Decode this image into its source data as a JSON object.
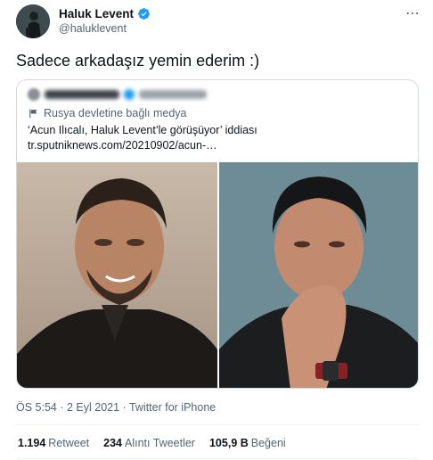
{
  "author": {
    "display_name": "Haluk Levent",
    "handle": "@haluklevent",
    "verified_icon": "verified-badge-icon",
    "verified_color": "#1d9bf0"
  },
  "more_icon": "⋯",
  "tweet": {
    "text": "Sadece arkadaşız yemin ederim :)"
  },
  "quote": {
    "state_media_label": "Rusya devletine bağlı medya",
    "title": "‘Acun Ilıcalı, Haluk Levent’le görüşüyor’ iddiası",
    "url": "tr.sputniknews.com/20210902/acun-…"
  },
  "meta": {
    "time": "ÖS 5:54",
    "date": "2 Eyl 2021",
    "separator": " · ",
    "app": "Twitter for iPhone"
  },
  "stats": {
    "retweets_count": "1.194",
    "retweets_label": "Retweet",
    "quotes_count": "234",
    "quotes_label": "Alıntı Tweetler",
    "likes_count": "105,9 B",
    "likes_label": "Beğeni"
  },
  "colors": {
    "text": "#0f1419",
    "secondary": "#536471",
    "border": "#cfd9de",
    "accent": "#1d9bf0"
  }
}
